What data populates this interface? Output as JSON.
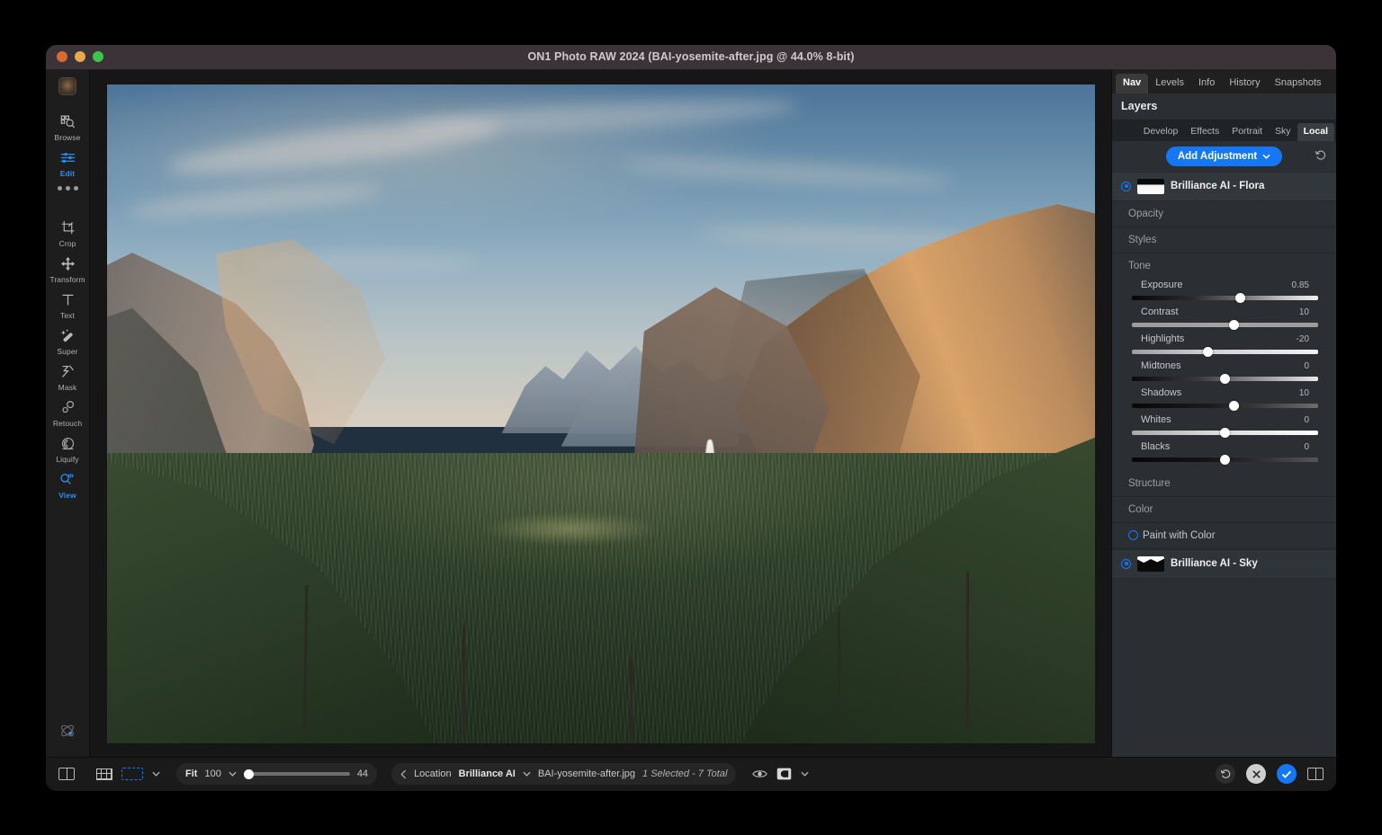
{
  "window": {
    "title": "ON1 Photo RAW 2024 (BAI-yosemite-after.jpg @ 44.0% 8-bit)"
  },
  "left_rail": {
    "tools": [
      {
        "label": "Browse",
        "icon": "browse-icon",
        "active": false
      },
      {
        "label": "Edit",
        "icon": "edit-sliders-icon",
        "active": true
      },
      {
        "label": "Crop",
        "icon": "crop-icon",
        "active": false
      },
      {
        "label": "Transform",
        "icon": "transform-icon",
        "active": false
      },
      {
        "label": "Text",
        "icon": "text-icon",
        "active": false
      },
      {
        "label": "Super",
        "icon": "magic-wand-icon",
        "active": false
      },
      {
        "label": "Mask",
        "icon": "mask-brush-icon",
        "active": false
      },
      {
        "label": "Retouch",
        "icon": "retouch-icon",
        "active": false
      },
      {
        "label": "Liquify",
        "icon": "liquify-icon",
        "active": false
      },
      {
        "label": "View",
        "icon": "view-zoom-icon",
        "active": true
      }
    ]
  },
  "right_panel": {
    "top_tabs": [
      {
        "label": "Nav",
        "active": true
      },
      {
        "label": "Levels",
        "active": false
      },
      {
        "label": "Info",
        "active": false
      },
      {
        "label": "History",
        "active": false
      },
      {
        "label": "Snapshots",
        "active": false
      }
    ],
    "layers_title": "Layers",
    "module_tabs": [
      {
        "label": "Develop",
        "active": false
      },
      {
        "label": "Effects",
        "active": false
      },
      {
        "label": "Portrait",
        "active": false
      },
      {
        "label": "Sky",
        "active": false
      },
      {
        "label": "Local",
        "active": true
      }
    ],
    "add_adjustment": "Add Adjustment",
    "layers": [
      {
        "name": "Brilliance AI - Flora",
        "mask": "ground-mask",
        "enabled": true
      },
      {
        "name": "Brilliance AI - Sky",
        "mask": "sky-mask",
        "enabled": true
      }
    ],
    "sections": {
      "opacity": "Opacity",
      "styles": "Styles",
      "tone": "Tone",
      "structure": "Structure",
      "color": "Color",
      "paint_with_color": "Paint with Color"
    },
    "tone_sliders": [
      {
        "label": "Exposure",
        "value": "0.85",
        "pos": 58
      },
      {
        "label": "Contrast",
        "value": "10",
        "pos": 55
      },
      {
        "label": "Highlights",
        "value": "-20",
        "pos": 41
      },
      {
        "label": "Midtones",
        "value": "0",
        "pos": 50
      },
      {
        "label": "Shadows",
        "value": "10",
        "pos": 55
      },
      {
        "label": "Whites",
        "value": "0",
        "pos": 50
      },
      {
        "label": "Blacks",
        "value": "0",
        "pos": 50
      }
    ],
    "accent_color": "#1677f2"
  },
  "bottom_bar": {
    "zoom_fit_label": "Fit",
    "zoom_preset": "100",
    "zoom_value": "44",
    "location_label": "Location",
    "location_value": "Brilliance AI",
    "filename": "BAI-yosemite-after.jpg",
    "selection_status": "1 Selected - 7 Total",
    "icons": {
      "panel_toggle": "panel-toggle-icon",
      "grid": "grid-view-icon",
      "selection": "selection-rect-icon",
      "chevron": "chevron-down-icon",
      "eye": "preview-eye-icon",
      "compare": "compare-icon",
      "reset": "reset-icon",
      "cancel": "cancel-icon",
      "confirm": "confirm-icon",
      "split": "split-view-icon"
    }
  }
}
